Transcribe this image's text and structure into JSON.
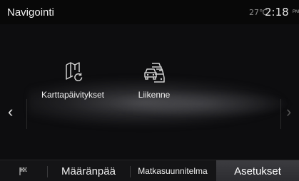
{
  "header": {
    "title": "Navigointi",
    "temperature": "27℃",
    "time": "2:18",
    "time_suffix": "PM"
  },
  "menu": {
    "items": [
      {
        "label": "Karttapäivitykset",
        "icon": "map-update-icon"
      },
      {
        "label": "Liikenne",
        "icon": "traffic-icon"
      }
    ],
    "prev_arrow": "‹",
    "next_arrow": "›"
  },
  "tabs": {
    "flag_icon": "flag-icon",
    "items": [
      {
        "label": "Määränpää"
      },
      {
        "label": "Matkasuunnitelma"
      },
      {
        "label": "Asetukset",
        "selected": true
      }
    ]
  }
}
